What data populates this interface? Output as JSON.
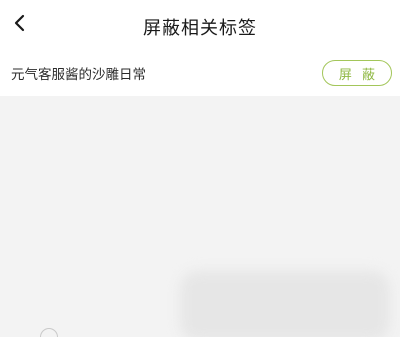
{
  "header": {
    "title": "屏蔽相关标签",
    "back_icon": "chevron-left-icon"
  },
  "tag_item": {
    "label": "元气客服酱的沙雕日常",
    "action_label": "屏 蔽"
  },
  "colors": {
    "accent": "#8fb843",
    "accent_border": "#a3c65a",
    "content_bg": "#f3f3f3"
  }
}
